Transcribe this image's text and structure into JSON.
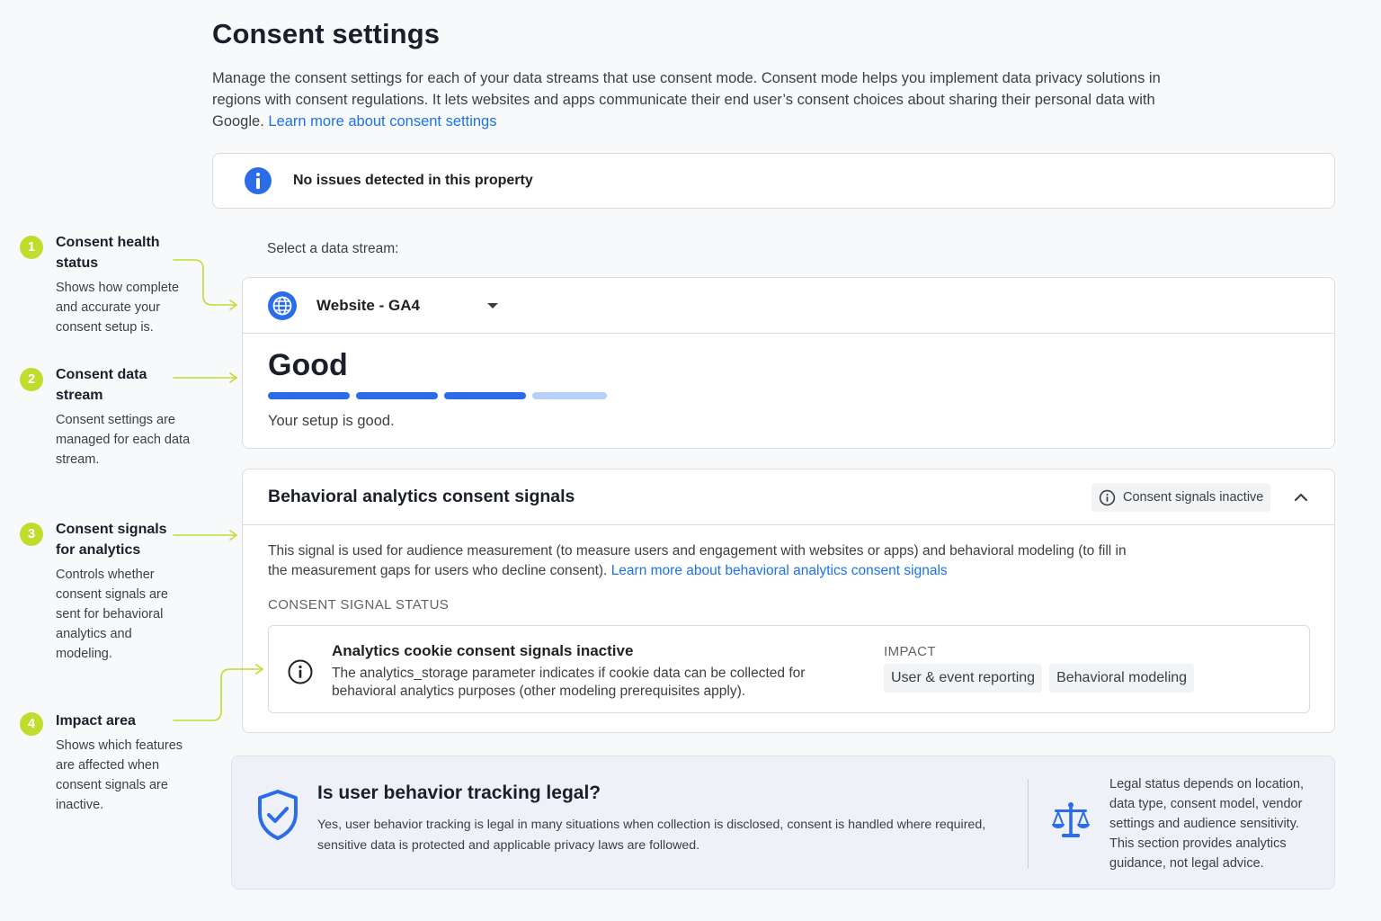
{
  "header": {
    "title": "Consent settings",
    "intro": "Manage the consent settings for each of your data streams that use consent mode. Consent mode helps you implement data privacy solutions in regions with consent regulations. It lets websites and apps communicate their end user’s consent choices about sharing their personal data with Google.",
    "learn_more": "Learn more about consent settings"
  },
  "alert": {
    "icon": "info-icon",
    "text": "No issues detected in this property"
  },
  "stream": {
    "select_label": "Select a data stream:",
    "icon": "globe-icon",
    "selected": "Website - GA4",
    "status": "Good",
    "meter_filled": 3,
    "meter_total": 4,
    "status_text": "Your setup is good."
  },
  "signals": {
    "title": "Behavioral analytics consent signals",
    "badge": "Consent signals inactive",
    "description": "This signal is used for audience measurement (to measure users and engagement with websites or apps) and behavioral modeling (to fill in the measurement gaps for users who decline consent).",
    "learn_more": "Learn more about behavioral analytics consent signals",
    "status_heading": "CONSENT SIGNAL STATUS",
    "row": {
      "title": "Analytics cookie consent signals inactive",
      "description": "The analytics_storage parameter indicates if cookie data can be collected for behavioral analytics purposes (other modeling prerequisites apply).",
      "impact_label": "IMPACT",
      "impacts": [
        "User & event reporting",
        "Behavioral modeling"
      ]
    }
  },
  "legal": {
    "title": "Is user behavior tracking legal?",
    "body": "Yes, user behavior tracking is legal in many situations when collection is disclosed, consent is handled where required, sensitive data is protected and applicable privacy laws are followed.",
    "note": "Legal status depends on location, data type, consent model, vendor settings and audience sensitivity. This section provides analytics guidance, not legal advice."
  },
  "annotations": [
    {
      "number": "1",
      "title": "Consent health status",
      "description": "Shows how complete and accurate your consent setup is."
    },
    {
      "number": "2",
      "title": "Consent data stream",
      "description": "Consent settings are managed for each data stream."
    },
    {
      "number": "3",
      "title": "Consent signals for analytics",
      "description": "Controls whether consent signals are sent for behavioral analytics and modeling."
    },
    {
      "number": "4",
      "title": "Impact area",
      "description": "Shows which features are affected when consent signals are inactive."
    }
  ],
  "colors": {
    "accent_blue": "#2b6de8",
    "link_blue": "#1a73e8",
    "meter_off": "#b7d0f7",
    "annotation_green": "#c0dc2c"
  }
}
